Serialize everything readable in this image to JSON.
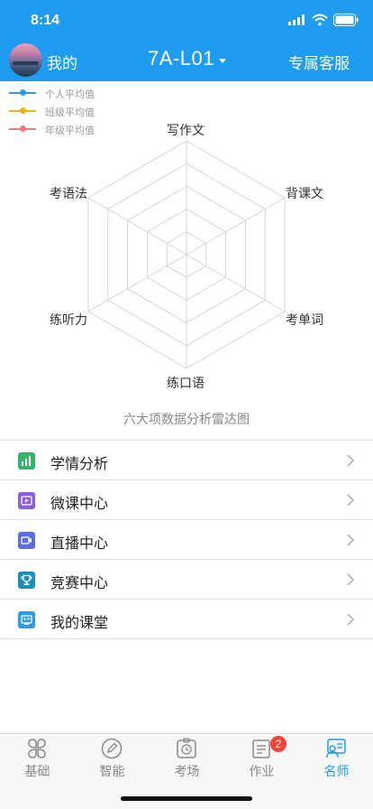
{
  "status": {
    "time": "8:14"
  },
  "nav": {
    "left_label": "我的",
    "title": "7A-L01",
    "right_label": "专属客服"
  },
  "legend": [
    {
      "label": "个人平均值",
      "color": "#2a9df4"
    },
    {
      "label": "班级平均值",
      "color": "#e6b422"
    },
    {
      "label": "年级平均值",
      "color": "#f0787a"
    }
  ],
  "chart_data": {
    "type": "radar",
    "axes": [
      "写作文",
      "背课文",
      "考单词",
      "练口语",
      "练听力",
      "考语法"
    ],
    "series": [
      {
        "name": "个人平均值",
        "values": []
      },
      {
        "name": "班级平均值",
        "values": []
      },
      {
        "name": "年级平均值",
        "values": []
      }
    ],
    "rings": 5,
    "caption": "六大项数据分析雷达图"
  },
  "menu": [
    {
      "label": "学情分析",
      "icon": "chart-icon",
      "color": "#35b36b"
    },
    {
      "label": "微课中心",
      "icon": "video-icon",
      "color": "#8b5fd6"
    },
    {
      "label": "直播中心",
      "icon": "live-camera-icon",
      "color": "#5b6fe0"
    },
    {
      "label": "竞赛中心",
      "icon": "trophy-icon",
      "color": "#1c8fb8"
    },
    {
      "label": "我的课堂",
      "icon": "classroom-icon",
      "color": "#2e9be6"
    }
  ],
  "tabs": [
    {
      "label": "基础",
      "icon": "clover-icon",
      "active": false
    },
    {
      "label": "智能",
      "icon": "pencil-circle-icon",
      "active": false
    },
    {
      "label": "考场",
      "icon": "exam-clock-icon",
      "active": false
    },
    {
      "label": "作业",
      "icon": "homework-icon",
      "active": false,
      "badge": "2"
    },
    {
      "label": "名师",
      "icon": "teacher-icon",
      "active": true
    }
  ],
  "colors": {
    "primary": "#1e9cf0",
    "badge": "#f2433b"
  }
}
